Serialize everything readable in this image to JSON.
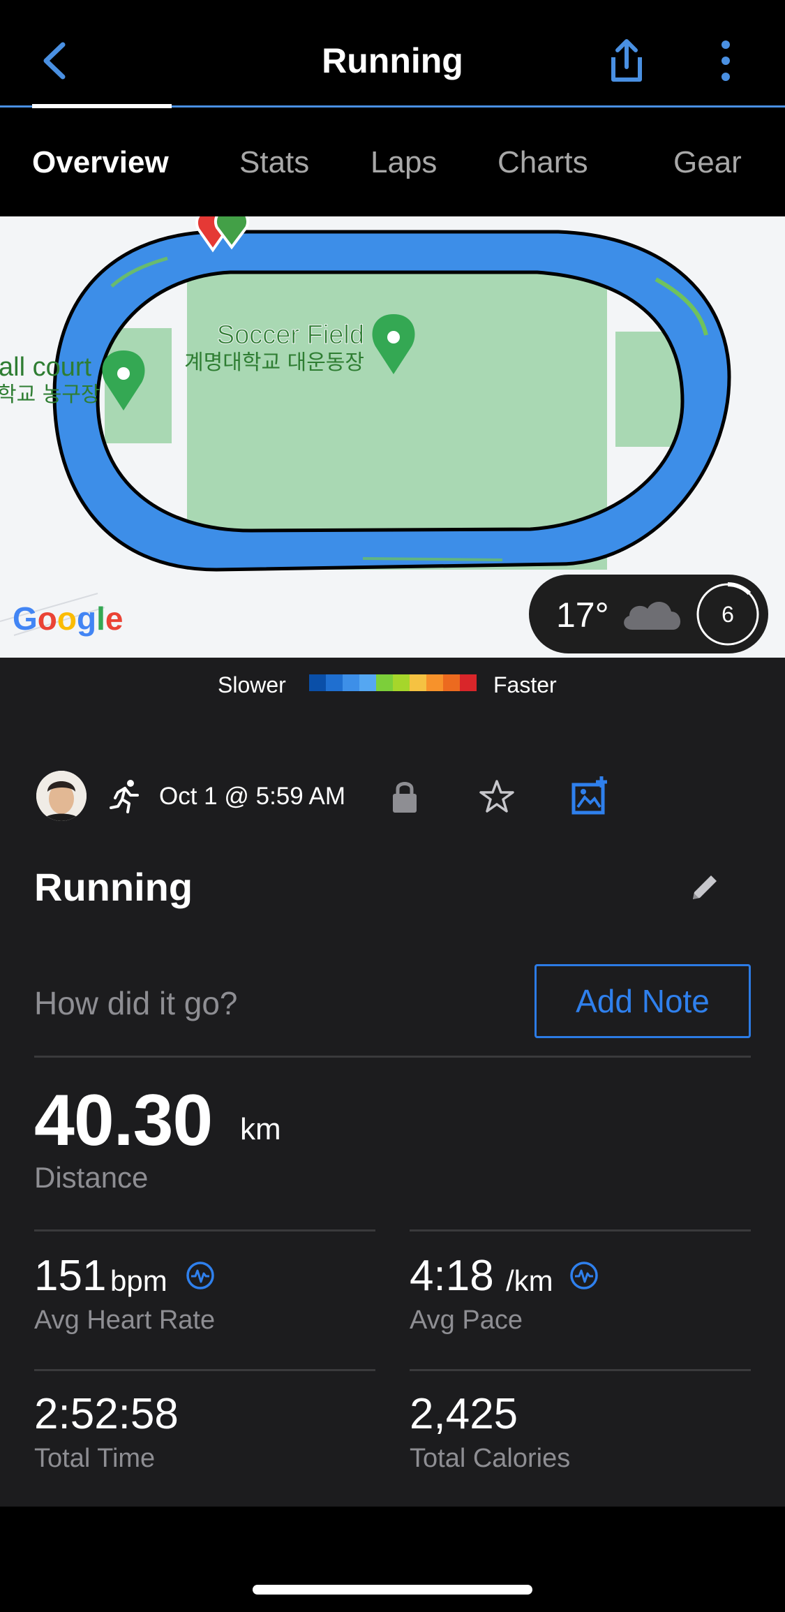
{
  "header": {
    "title": "Running",
    "back_icon": "chevron-left-icon",
    "share_icon": "share-icon",
    "more_icon": "more-vertical-icon"
  },
  "tabs": [
    {
      "label": "Overview",
      "active": true
    },
    {
      "label": "Stats",
      "active": false
    },
    {
      "label": "Laps",
      "active": false
    },
    {
      "label": "Charts",
      "active": false
    },
    {
      "label": "Gear",
      "active": false
    }
  ],
  "map": {
    "poi_soccer_en": "Soccer Field",
    "poi_soccer_ko": "계명대학교 대운동장",
    "poi_court_en": "all court",
    "poi_court_ko": "학교 농구장",
    "attribution": "Google"
  },
  "weather": {
    "temperature": "17°",
    "condition_icon": "cloud-icon",
    "uv_index": "6"
  },
  "pace_legend": {
    "slower": "Slower",
    "faster": "Faster",
    "colors": [
      "#0a4fa8",
      "#1f6fd0",
      "#3d8fe8",
      "#55a7f2",
      "#7ccf3a",
      "#a6d62b",
      "#f5c242",
      "#f7922b",
      "#ec6a1f",
      "#d9262a"
    ]
  },
  "activity": {
    "date": "Oct 1 @ 5:59 AM",
    "name": "Running",
    "note_prompt": "How did it go?",
    "add_note_label": "Add Note"
  },
  "stats": {
    "distance": {
      "value": "40.30",
      "unit": "km",
      "label": "Distance"
    },
    "heart_rate": {
      "value": "151",
      "unit": "bpm",
      "label": "Avg Heart Rate"
    },
    "pace": {
      "value": "4:18",
      "unit": "/km",
      "label": "Avg Pace"
    },
    "time": {
      "value": "2:52:58",
      "label": "Total Time"
    },
    "calories": {
      "value": "2,425",
      "label": "Total Calories"
    }
  },
  "colors": {
    "accent": "#4a90e2",
    "background": "#1c1c1e",
    "route": "#3d8ee8",
    "field_green": "#a9d8b3"
  }
}
